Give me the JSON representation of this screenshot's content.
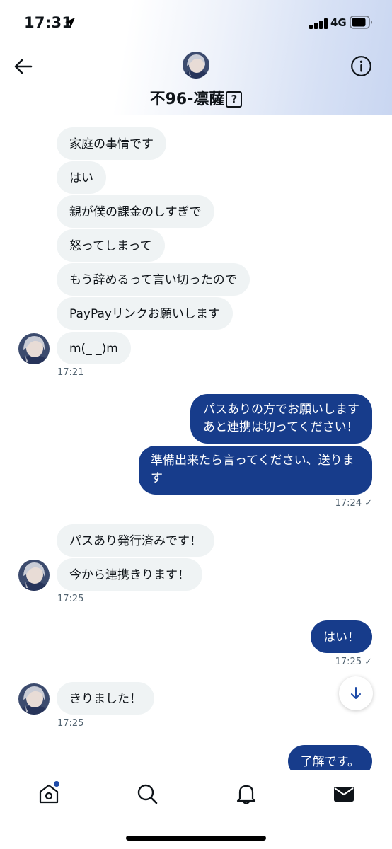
{
  "status_bar": {
    "time": "17:31",
    "network": "4G"
  },
  "header": {
    "title": "不96-凛薩",
    "badge": "?"
  },
  "conversation": {
    "incoming_1": [
      "家庭の事情です",
      "はい",
      "親が僕の課金のしすぎで",
      "怒ってしまって",
      "もう辞めるって言い切ったので",
      "PayPayリンクお願いします",
      "m(_ _)m"
    ],
    "incoming_1_time": "17:21",
    "outgoing_1": [
      "パスありの方でお願いします",
      "あと連携は切ってください！"
    ],
    "outgoing_2": [
      "準備出来たら言ってください、送りま",
      "す"
    ],
    "outgoing_2_time": "17:24",
    "incoming_2": [
      "パスあり発行済みです！",
      "今から連携きります！"
    ],
    "incoming_2_time": "17:25",
    "outgoing_3": "はい！",
    "outgoing_3_time": "17:25",
    "incoming_3": "きりました！",
    "incoming_3_time": "17:25",
    "outgoing_4": "了解です。",
    "read_check": "✓"
  },
  "colors": {
    "outgoing_bubble": "#173c8b",
    "incoming_bubble": "#eff3f4",
    "accent": "#1d4aa7"
  },
  "icons": [
    "back-arrow-icon",
    "info-icon",
    "scroll-down-icon",
    "home-icon",
    "search-icon",
    "bell-icon",
    "mail-icon"
  ]
}
